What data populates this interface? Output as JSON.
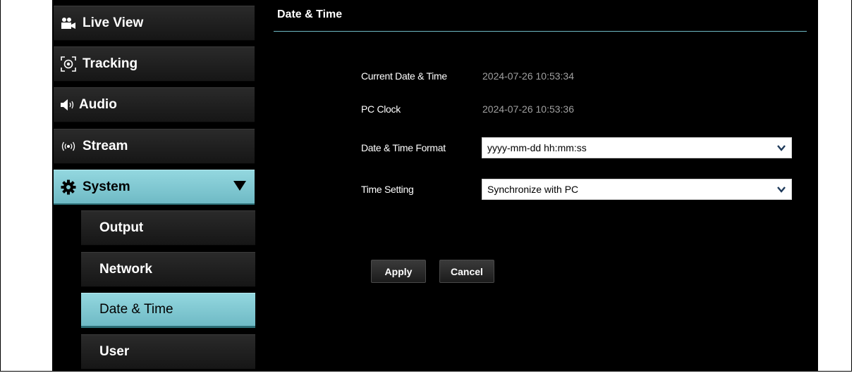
{
  "sidebar": {
    "items": [
      {
        "label": "Live View",
        "icon": "camcorder-icon"
      },
      {
        "label": "Tracking",
        "icon": "tracking-target-icon"
      },
      {
        "label": "Audio",
        "icon": "speaker-icon"
      },
      {
        "label": "Stream",
        "icon": "broadcast-icon"
      },
      {
        "label": "System",
        "icon": "gear-icon",
        "expanded": true
      }
    ],
    "subitems": [
      {
        "label": "Output"
      },
      {
        "label": "Network"
      },
      {
        "label": "Date & Time",
        "active": true
      },
      {
        "label": "User"
      }
    ]
  },
  "main": {
    "title": "Date & Time",
    "current_label": "Current Date & Time",
    "current_value": "2024-07-26 10:53:34",
    "pc_label": "PC Clock",
    "pc_value": "2024-07-26 10:53:36",
    "format_label": "Date & Time Format",
    "format_value": "yyyy-mm-dd hh:mm:ss",
    "setting_label": "Time Setting",
    "setting_value": "Synchronize with PC",
    "apply_label": "Apply",
    "cancel_label": "Cancel"
  },
  "colors": {
    "accent": "#6fbac5",
    "background": "#000000",
    "nav_bg": "#1f1f1f"
  }
}
